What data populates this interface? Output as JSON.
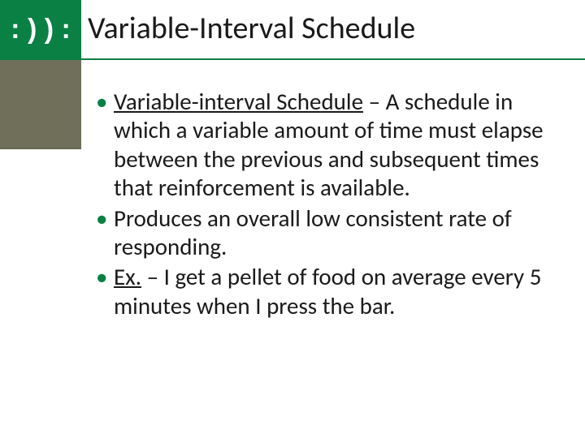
{
  "colors": {
    "accent": "#0a8044",
    "side": "#6f6f5a"
  },
  "logo_text": ": ) ) :",
  "title": "Variable-Interval Schedule",
  "bullets": [
    {
      "term": "Variable-interval Schedule",
      "sep": " – ",
      "text": "A schedule in which a variable amount of time must elapse between the previous and subsequent times that reinforcement is available."
    },
    {
      "term": "",
      "sep": "",
      "text": "Produces an overall low consistent rate of responding."
    },
    {
      "term": "Ex.",
      "sep": " – ",
      "text": "I get a pellet of food on average every 5 minutes when I press the bar."
    }
  ]
}
